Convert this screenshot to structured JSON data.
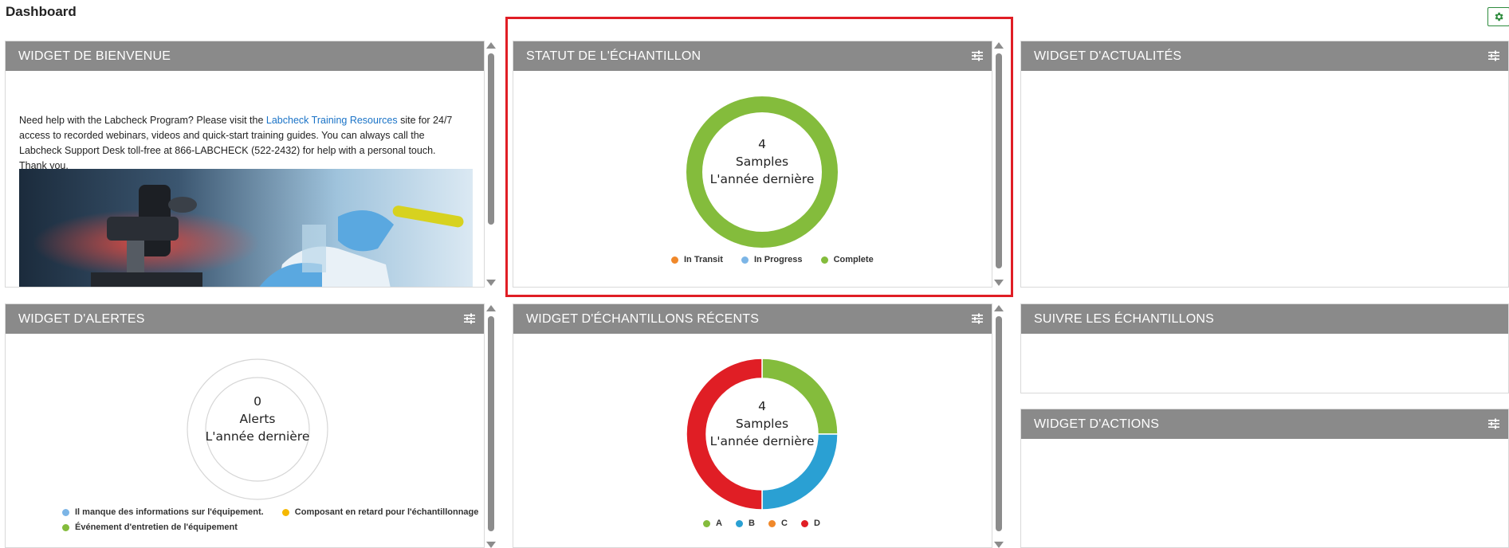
{
  "page": {
    "title": "Dashboard"
  },
  "colors": {
    "header_bg": "#8a8a8a",
    "highlight": "#e01e25",
    "green": "#84bc3c",
    "blue": "#2aa0d3",
    "orange": "#f0882a",
    "red": "#e01e25",
    "light_blue": "#7cb5e6",
    "yellow": "#f5b800"
  },
  "icons": {
    "settings": "gear-icon",
    "widget_menu": "sliders-icon"
  },
  "widgets": {
    "welcome": {
      "title": "WIDGET DE BIENVENUE",
      "text_before": "Need help with the Labcheck Program? Please visit the ",
      "link": "Labcheck Training Resources",
      "text_after": " site for 24/7 access to recorded webinars, videos and quick-start training guides. You can always call the Labcheck Support Desk toll-free at 866-LABCHECK (522-2432) for help with a personal touch. Thank you."
    },
    "sample_status": {
      "title": "STATUT DE L'ÉCHANTILLON",
      "count": "4",
      "unit": "Samples",
      "period": "L'année dernière",
      "legend": [
        "In Transit",
        "In Progress",
        "Complete"
      ]
    },
    "news": {
      "title": "WIDGET D'ACTUALITÉS"
    },
    "alerts": {
      "title": "WIDGET D'ALERTES",
      "count": "0",
      "unit": "Alerts",
      "period": "L'année dernière",
      "legend": [
        "Il manque des informations sur l'équipement.",
        "Composant en retard pour l'échantillonnage",
        "Événement d'entretien de l'équipement"
      ]
    },
    "recent_samples": {
      "title": "WIDGET D'ÉCHANTILLONS RÉCENTS",
      "count": "4",
      "unit": "Samples",
      "period": "L'année dernière",
      "legend": [
        "A",
        "B",
        "C",
        "D"
      ]
    },
    "track_samples": {
      "title": "SUIVRE LES ÉCHANTILLONS"
    },
    "actions": {
      "title": "WIDGET D'ACTIONS"
    }
  },
  "chart_data": [
    {
      "type": "pie",
      "categories": [
        "In Transit",
        "In Progress",
        "Complete"
      ],
      "values": [
        0,
        0,
        4
      ],
      "colors": [
        "#f0882a",
        "#7cb5e6",
        "#84bc3c"
      ],
      "center_text": [
        "4",
        "Samples",
        "L'année dernière"
      ],
      "legend": "bottom"
    },
    {
      "type": "pie",
      "categories": [
        "Il manque des informations sur l'équipement.",
        "Composant en retard pour l'échantillonnage",
        "Événement d'entretien de l'équipement"
      ],
      "values": [
        0,
        0,
        0
      ],
      "colors": [
        "#7cb5e6",
        "#f5b800",
        "#84bc3c"
      ],
      "center_text": [
        "0",
        "Alerts",
        "L'année dernière"
      ],
      "legend": "bottom"
    },
    {
      "type": "pie",
      "categories": [
        "A",
        "B",
        "C",
        "D"
      ],
      "values": [
        1,
        1,
        0,
        2
      ],
      "colors": [
        "#84bc3c",
        "#2aa0d3",
        "#f0882a",
        "#e01e25"
      ],
      "center_text": [
        "4",
        "Samples",
        "L'année dernière"
      ],
      "legend": "bottom"
    }
  ]
}
